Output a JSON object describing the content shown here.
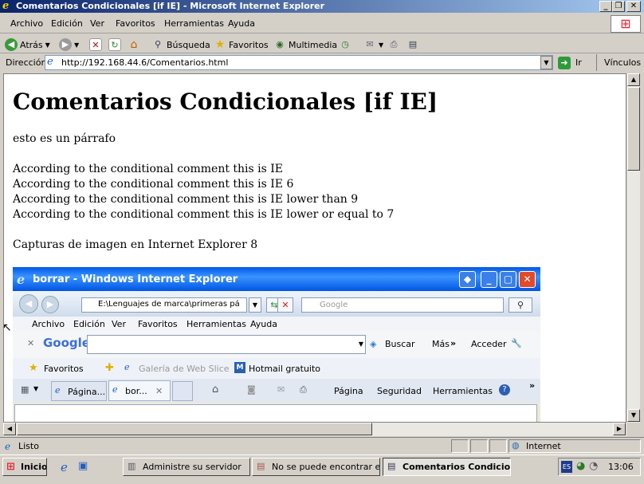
{
  "window": {
    "title": "Comentarios Condicionales [if IE] - Microsoft Internet Explorer"
  },
  "menubar": {
    "items": [
      "Archivo",
      "Edición",
      "Ver",
      "Favoritos",
      "Herramientas",
      "Ayuda"
    ]
  },
  "toolbar": {
    "back": "Atrás",
    "search": "Búsqueda",
    "favorites": "Favoritos",
    "media": "Multimedia"
  },
  "addressbar": {
    "label": "Dirección",
    "url": "http://192.168.44.6/Comentarios.html",
    "go": "Ir",
    "links": "Vínculos"
  },
  "page": {
    "heading": "Comentarios Condicionales [if IE]",
    "paragraph": "esto es un párrafo",
    "lines": [
      "According to the conditional comment this is IE",
      "According to the conditional comment this is IE 6",
      "According to the conditional comment this is IE lower than 9",
      "According to the conditional comment this is IE lower or equal to 7"
    ],
    "captions": "Capturas de imagen en Internet Explorer 8"
  },
  "screenshot": {
    "title": "borrar - Windows Internet Explorer",
    "address": "E:\\Lenguajes de marca\\primeras pá",
    "search_placeholder": "Google",
    "menus": [
      "Archivo",
      "Edición",
      "Ver",
      "Favoritos",
      "Herramientas",
      "Ayuda"
    ],
    "google_logo": "Google",
    "buscar": "Buscar",
    "mas": "Más",
    "acceder": "Acceder",
    "favoritos": "Favoritos",
    "galeria": "Galería de Web Slice",
    "hotmail": "Hotmail gratuito",
    "tab1": "Página...",
    "tab2": "bor...",
    "cmd_pagina": "Página",
    "cmd_seguridad": "Seguridad",
    "cmd_herramientas": "Herramientas"
  },
  "statusbar": {
    "text": "Listo",
    "zone": "Internet"
  },
  "taskbar": {
    "start": "Inicio",
    "tasks": [
      "Administre su servidor",
      "No se puede encontrar e...",
      "Comentarios Condicio..."
    ],
    "lang": "ES",
    "clock": "13:06"
  },
  "colors": {
    "titlebar": "#0a246a",
    "xp_blue": "#0058e6",
    "close_red": "#e04a2a"
  }
}
